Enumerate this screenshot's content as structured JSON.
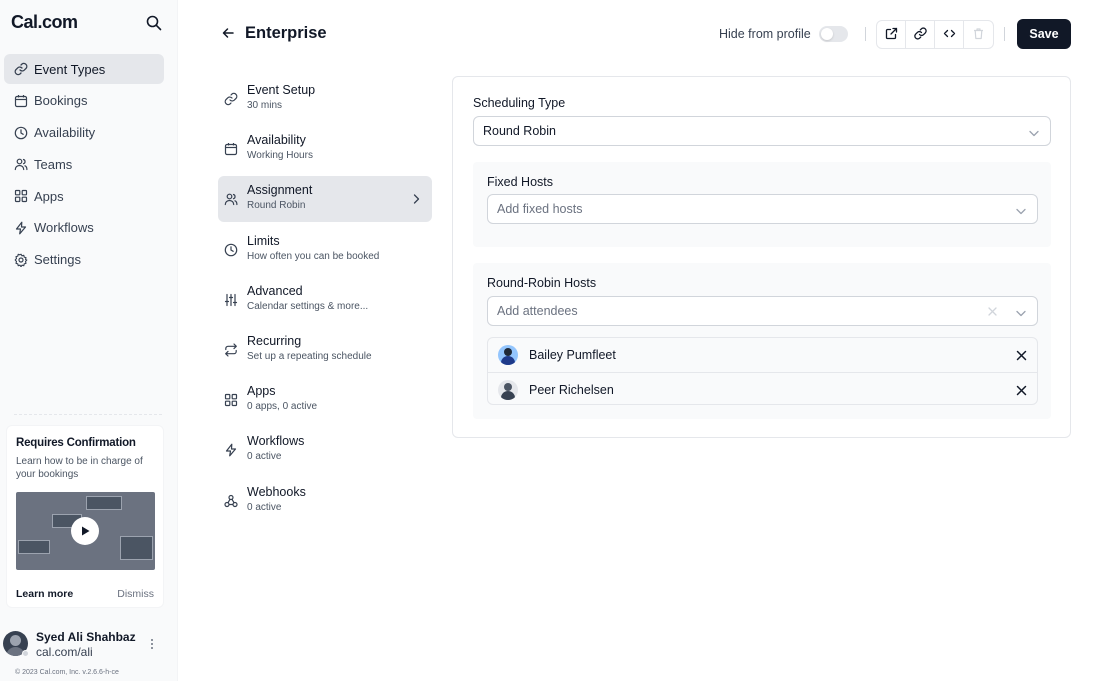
{
  "sidebar": {
    "logo": "Cal.com",
    "nav": [
      {
        "label": "Event Types",
        "icon": "link-icon",
        "active": true
      },
      {
        "label": "Bookings",
        "icon": "calendar-icon"
      },
      {
        "label": "Availability",
        "icon": "clock-icon"
      },
      {
        "label": "Teams",
        "icon": "users-icon"
      },
      {
        "label": "Apps",
        "icon": "grid-icon"
      },
      {
        "label": "Workflows",
        "icon": "zap-icon"
      },
      {
        "label": "Settings",
        "icon": "gear-icon"
      }
    ],
    "promo": {
      "title": "Requires Confirmation",
      "description": "Learn how to be in charge of your bookings",
      "learn_more": "Learn more",
      "dismiss": "Dismiss"
    },
    "user": {
      "name": "Syed Ali Shahbaz",
      "handle": "cal.com/ali"
    },
    "copyright": "© 2023 Cal.com, Inc. v.2.6.6-h-ce"
  },
  "header": {
    "title": "Enterprise",
    "hide_from_profile": "Hide from profile",
    "save": "Save"
  },
  "tabs": [
    {
      "label": "Event Setup",
      "sub": "30 mins",
      "icon": "link-icon"
    },
    {
      "label": "Availability",
      "sub": "Working Hours",
      "icon": "calendar-icon"
    },
    {
      "label": "Assignment",
      "sub": "Round Robin",
      "icon": "users-icon",
      "active": true
    },
    {
      "label": "Limits",
      "sub": "How often you can be booked",
      "icon": "clock-icon"
    },
    {
      "label": "Advanced",
      "sub": "Calendar settings & more...",
      "icon": "sliders-icon"
    },
    {
      "label": "Recurring",
      "sub": "Set up a repeating schedule",
      "icon": "repeat-icon"
    },
    {
      "label": "Apps",
      "sub": "0 apps, 0 active",
      "icon": "grid-icon"
    },
    {
      "label": "Workflows",
      "sub": "0 active",
      "icon": "zap-icon"
    },
    {
      "label": "Webhooks",
      "sub": "0 active",
      "icon": "webhook-icon"
    }
  ],
  "assignment": {
    "scheduling_type_label": "Scheduling Type",
    "scheduling_type_value": "Round Robin",
    "fixed_hosts_label": "Fixed Hosts",
    "fixed_hosts_placeholder": "Add fixed hosts",
    "rr_hosts_label": "Round-Robin Hosts",
    "rr_hosts_placeholder": "Add attendees",
    "hosts": [
      {
        "name": "Bailey Pumfleet"
      },
      {
        "name": "Peer Richelsen"
      }
    ]
  },
  "colors": {
    "brand": "#111827",
    "active_bg": "#e5e7eb",
    "sidebar_bg": "#f9fafb",
    "border": "#e5e7eb"
  }
}
